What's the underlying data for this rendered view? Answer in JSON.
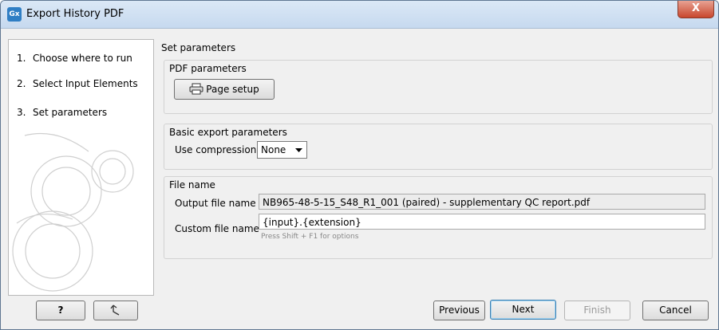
{
  "window": {
    "title": "Export History PDF",
    "app_icon_text": "Gx",
    "close_glyph": "X"
  },
  "steps": [
    {
      "num": "1.",
      "label": "Choose where to run"
    },
    {
      "num": "2.",
      "label": "Select Input Elements"
    },
    {
      "num": "3.",
      "label": "Set parameters"
    }
  ],
  "panel": {
    "title": "Set parameters",
    "pdf_group": {
      "label": "PDF parameters",
      "page_setup_label": "Page setup"
    },
    "basic_group": {
      "label": "Basic export parameters",
      "compression_label": "Use compression",
      "compression_value": "None"
    },
    "file_group": {
      "label": "File name",
      "output_label": "Output file name",
      "output_value": "NB965-48-5-15_S48_R1_001 (paired) - supplementary QC report.pdf",
      "custom_label": "Custom file name",
      "custom_value": "{input}.{extension}",
      "custom_hint": "Press Shift + F1 for options"
    }
  },
  "buttons": {
    "help": "?",
    "previous": "Previous",
    "next": "Next",
    "finish": "Finish",
    "cancel": "Cancel"
  },
  "icons": {
    "app": "gx-app-icon",
    "page_setup": "printer-icon",
    "reset": "reset-arrow-icon",
    "dropdown": "chevron-down-icon"
  }
}
